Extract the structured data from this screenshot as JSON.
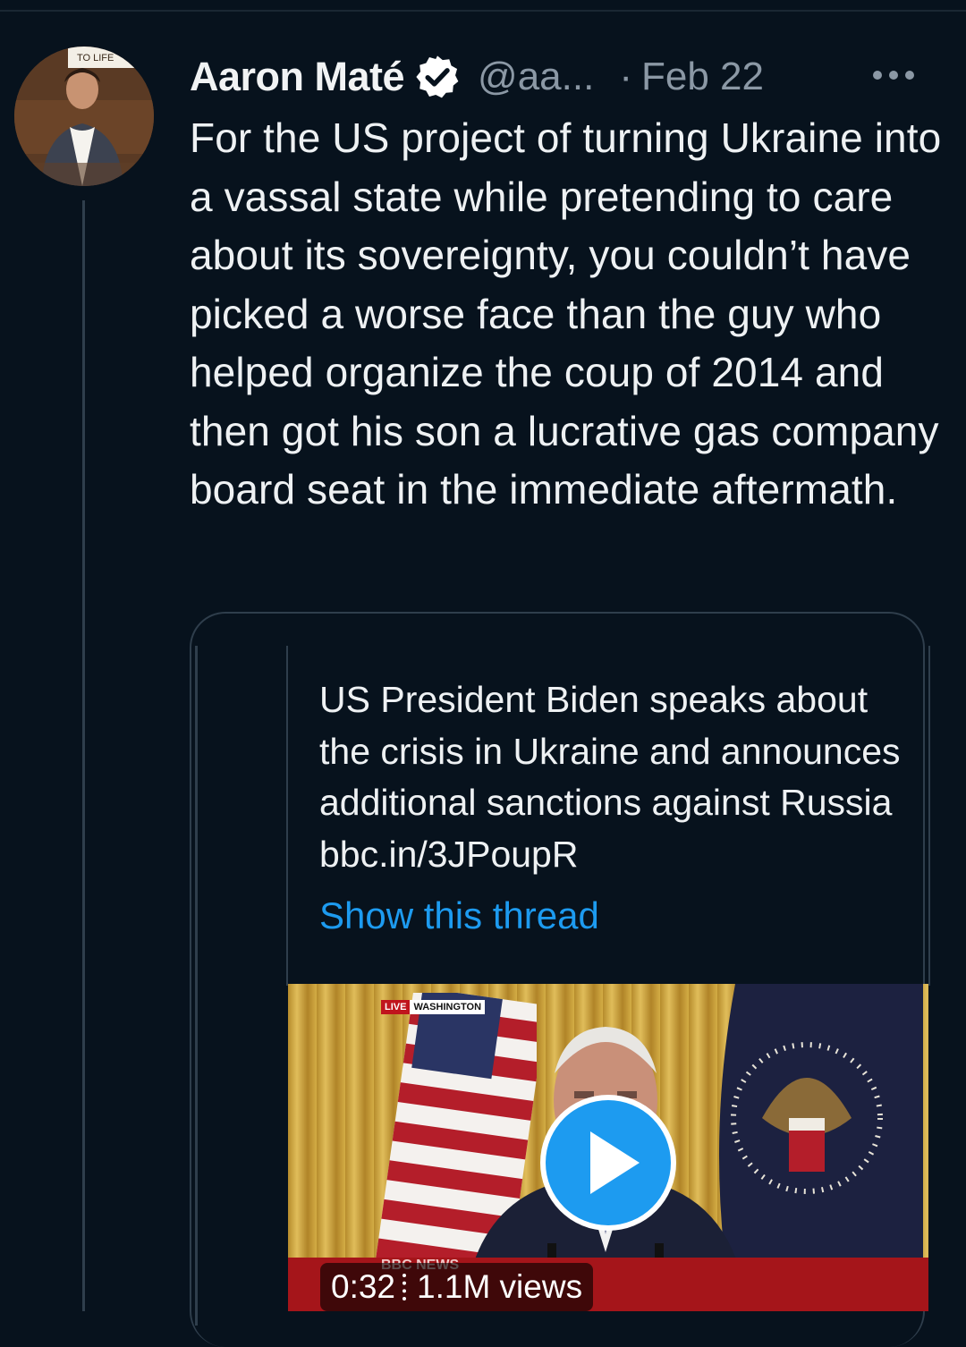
{
  "author": {
    "name": "Aaron Maté",
    "handle": "@aa...",
    "separator": "·",
    "date": "Feb 22",
    "verified": true,
    "avatar_sign_text": "TO LIFE"
  },
  "tweet": {
    "text": "For the US project of turning Ukraine into a vassal state while pretending to care about its sovereignty, you couldn’t have picked a worse face than the guy who helped organize the coup of 2014 and then got his son a lucrative gas company board seat in the immediate aftermath."
  },
  "quoted_tweet": {
    "text": "US President Biden speaks about the crisis in Ukraine and announces additional sanctions against Russia bbc.in/3JPoupR",
    "show_thread_label": "Show this thread",
    "video": {
      "live_label": "LIVE",
      "location_label": "WASHINGTON",
      "broadcaster_mark": "BBC NEWS",
      "duration": "0:32",
      "views": "1.1M views"
    }
  },
  "colors": {
    "background": "#07121d",
    "text": "#eef1f3",
    "muted": "#8b98a5",
    "link": "#1d9bf0",
    "verified": "#ffffff",
    "border": "#2f3e4c"
  },
  "icons": [
    "verified-badge-icon",
    "more-options-icon",
    "play-icon"
  ]
}
